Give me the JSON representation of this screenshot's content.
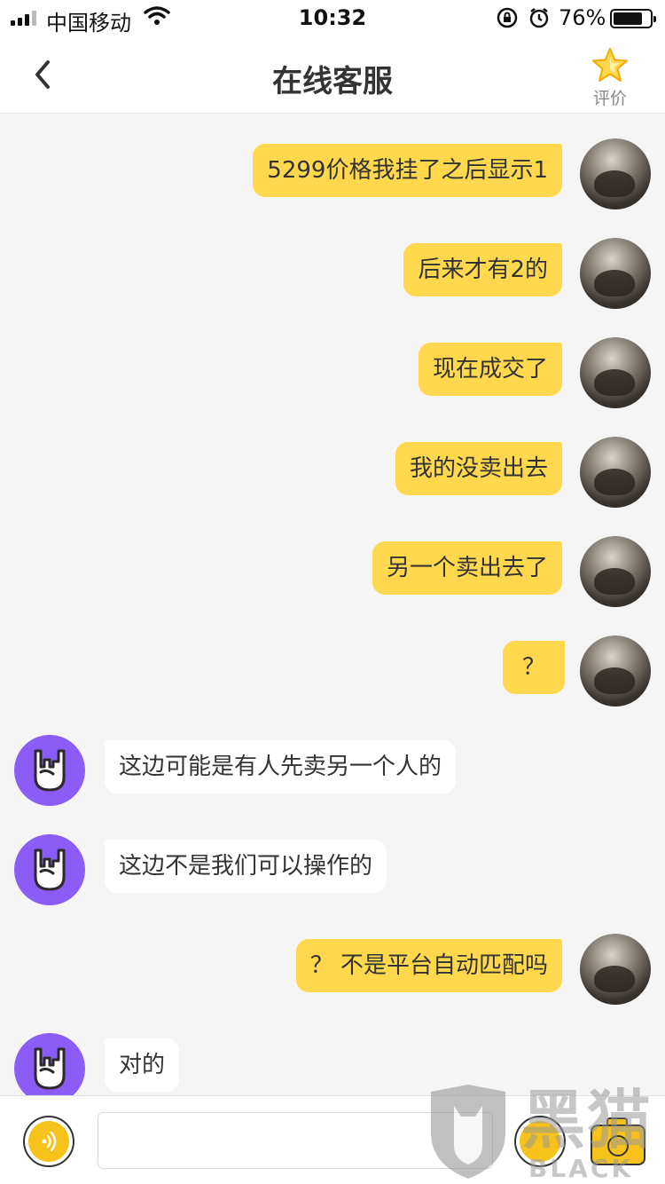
{
  "status_bar": {
    "carrier": "中国移动",
    "time": "10:32",
    "battery": "76%"
  },
  "header": {
    "title": "在线客服",
    "back_icon": "chevron-left-icon",
    "rate_label": "评价",
    "rate_icon": "star-icon"
  },
  "messages": [
    {
      "side": "out",
      "text": "5299价格我挂了之后显示1"
    },
    {
      "side": "out",
      "text": "后来才有2的"
    },
    {
      "side": "out",
      "text": "现在成交了"
    },
    {
      "side": "out",
      "text": "我的没卖出去"
    },
    {
      "side": "out",
      "text": "另一个卖出去了"
    },
    {
      "side": "out",
      "text": "？"
    },
    {
      "side": "in",
      "text": "这边可能是有人先卖另一个人的"
    },
    {
      "side": "in",
      "text": "这边不是我们可以操作的"
    },
    {
      "side": "out",
      "text": "？ 不是平台自动匹配吗"
    },
    {
      "side": "in",
      "text": "对的"
    }
  ],
  "input_bar": {
    "placeholder": "",
    "voice_icon": "voice-icon",
    "emoji_icon": "emoji-icon",
    "camera_icon": "camera-icon"
  },
  "watermark": {
    "cn": "黑猫",
    "en": "BLACK CAT"
  },
  "colors": {
    "outgoing_bubble": "#ffd84d",
    "incoming_bubble": "#ffffff",
    "bot_avatar": "#8b5cf6",
    "accent": "#f7c21a",
    "background": "#f5f5f5"
  }
}
